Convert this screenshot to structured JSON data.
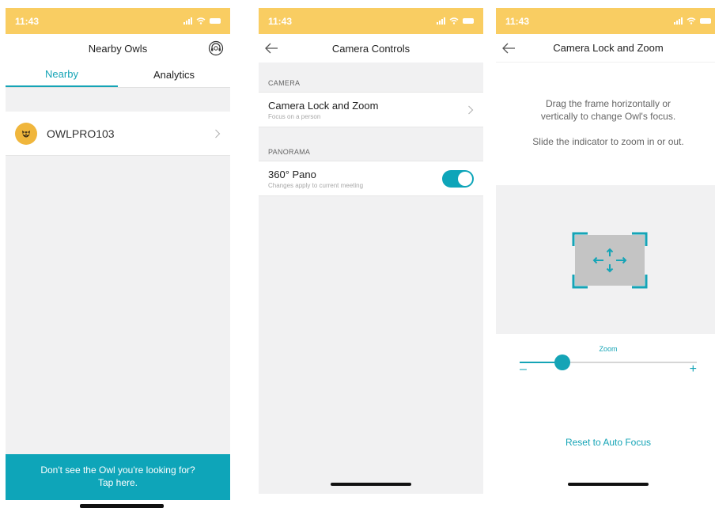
{
  "screen1": {
    "status_time": "11:43",
    "title": "Nearby Owls",
    "tabs": [
      {
        "label": "Nearby",
        "active": true
      },
      {
        "label": "Analytics",
        "active": false
      }
    ],
    "device": {
      "name": "OWLPRO103",
      "icon": "owl-logo-icon"
    },
    "footer": {
      "line1": "Don't see the Owl you're looking for?",
      "line2": "Tap here."
    }
  },
  "screen2": {
    "status_time": "11:43",
    "title": "Camera Controls",
    "sections": [
      {
        "label": "CAMERA",
        "row": {
          "title": "Camera Lock and Zoom",
          "subtitle": "Focus on a person",
          "control": "chevron"
        }
      },
      {
        "label": "PANORAMA",
        "row": {
          "title": "360° Pano",
          "subtitle": "Changes apply to current meeting",
          "control": "toggle",
          "enabled": true
        }
      }
    ]
  },
  "screen3": {
    "status_time": "11:43",
    "title": "Camera Lock and Zoom",
    "instruction_line1": "Drag the frame horizontally or",
    "instruction_line2": "vertically to change Owl's focus.",
    "instruction_line3": "Slide the indicator to zoom in or out.",
    "zoom_label": "Zoom",
    "zoom_min_label": "–",
    "zoom_max_label": "+",
    "zoom_level": 0.24,
    "reset_label": "Reset to Auto Focus"
  },
  "colors": {
    "status_bar": "#f9cd62",
    "accent": "#15a4b6",
    "footer_bg": "#0ea5b9",
    "section_bg": "#f1f1f2",
    "owl_logo": "#f0b63c"
  }
}
